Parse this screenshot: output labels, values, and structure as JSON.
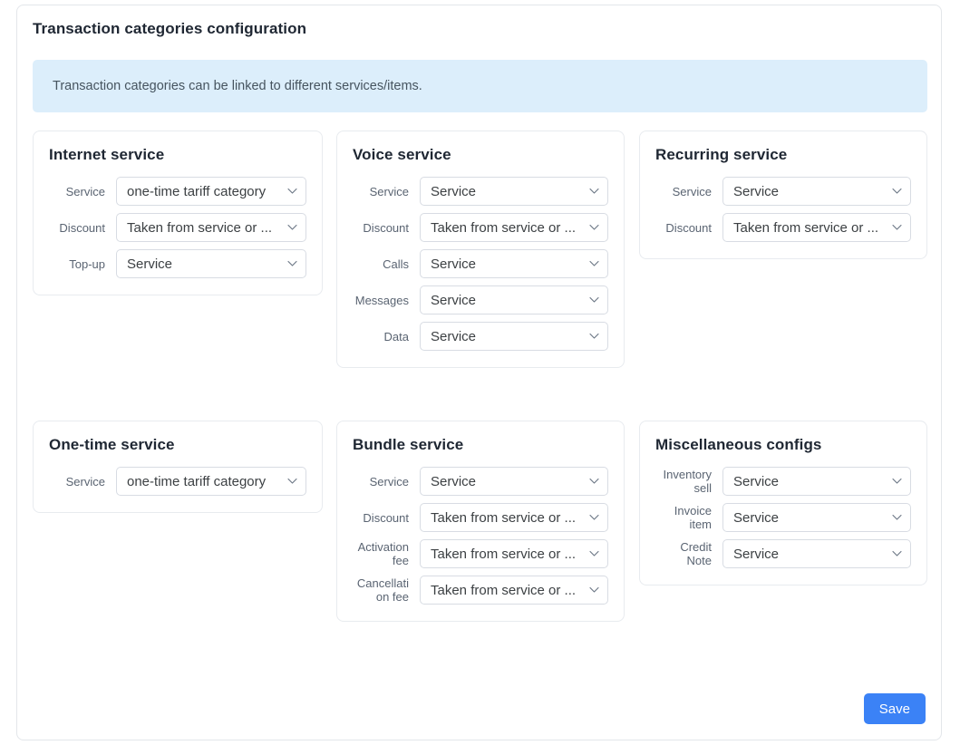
{
  "panel": {
    "title": "Transaction categories configuration",
    "info_banner": "Transaction categories can be linked to different services/items.",
    "save_label": "Save",
    "accent_color": "#3b82f6",
    "banner_color": "#dceefb"
  },
  "cards": [
    {
      "title": "Internet service",
      "fields": [
        {
          "label": "Service",
          "value": "one-time tariff category"
        },
        {
          "label": "Discount",
          "value": "Taken from service or ..."
        },
        {
          "label": "Top-up",
          "value": "Service"
        }
      ]
    },
    {
      "title": "Voice service",
      "fields": [
        {
          "label": "Service",
          "value": "Service"
        },
        {
          "label": "Discount",
          "value": "Taken from service or ..."
        },
        {
          "label": "Calls",
          "value": "Service"
        },
        {
          "label": "Messages",
          "value": "Service"
        },
        {
          "label": "Data",
          "value": "Service"
        }
      ]
    },
    {
      "title": "Recurring service",
      "fields": [
        {
          "label": "Service",
          "value": "Service"
        },
        {
          "label": "Discount",
          "value": "Taken from service or ..."
        }
      ]
    },
    {
      "title": "One-time service",
      "fields": [
        {
          "label": "Service",
          "value": "one-time tariff category"
        }
      ]
    },
    {
      "title": "Bundle service",
      "fields": [
        {
          "label": "Service",
          "value": "Service"
        },
        {
          "label": "Discount",
          "value": "Taken from service or ..."
        },
        {
          "label": "Activation fee",
          "value": "Taken from service or ..."
        },
        {
          "label": "Cancellation fee",
          "value": "Taken from service or ..."
        }
      ]
    },
    {
      "title": "Miscellaneous configs",
      "fields": [
        {
          "label": "Inventory sell",
          "value": "Service"
        },
        {
          "label": "Invoice item",
          "value": "Service"
        },
        {
          "label": "Credit Note",
          "value": "Service"
        }
      ]
    }
  ],
  "icons": {
    "chevron": "chevron-down-icon"
  }
}
